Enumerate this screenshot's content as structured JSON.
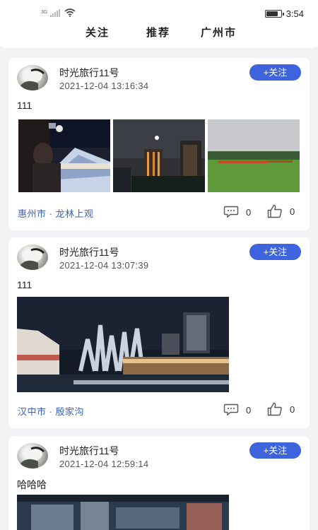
{
  "status_bar": {
    "network": "3G",
    "time": "3:54",
    "battery_level": 0.85
  },
  "tabs": [
    {
      "label": "关注",
      "selected": false
    },
    {
      "label": "推荐",
      "selected": true
    },
    {
      "label": "广州市",
      "selected": false
    }
  ],
  "posts": [
    {
      "username": "时光旅行11号",
      "timestamp": "2021-12-04 13:16:34",
      "follow_label": "+关注",
      "text": "111",
      "location": "惠州市 · 龙林上观",
      "comments": "0",
      "likes": "0"
    },
    {
      "username": "时光旅行11号",
      "timestamp": "2021-12-04 13:07:39",
      "follow_label": "+关注",
      "text": "111",
      "location": "汉中市 · 殷家沟",
      "comments": "0",
      "likes": "0"
    },
    {
      "username": "时光旅行11号",
      "timestamp": "2021-12-04 12:59:14",
      "follow_label": "+关注",
      "text": "哈哈哈"
    }
  ],
  "colors": {
    "accent": "#3d63dd",
    "location": "#3d63b8",
    "tab_underline": "#2d4db8"
  }
}
